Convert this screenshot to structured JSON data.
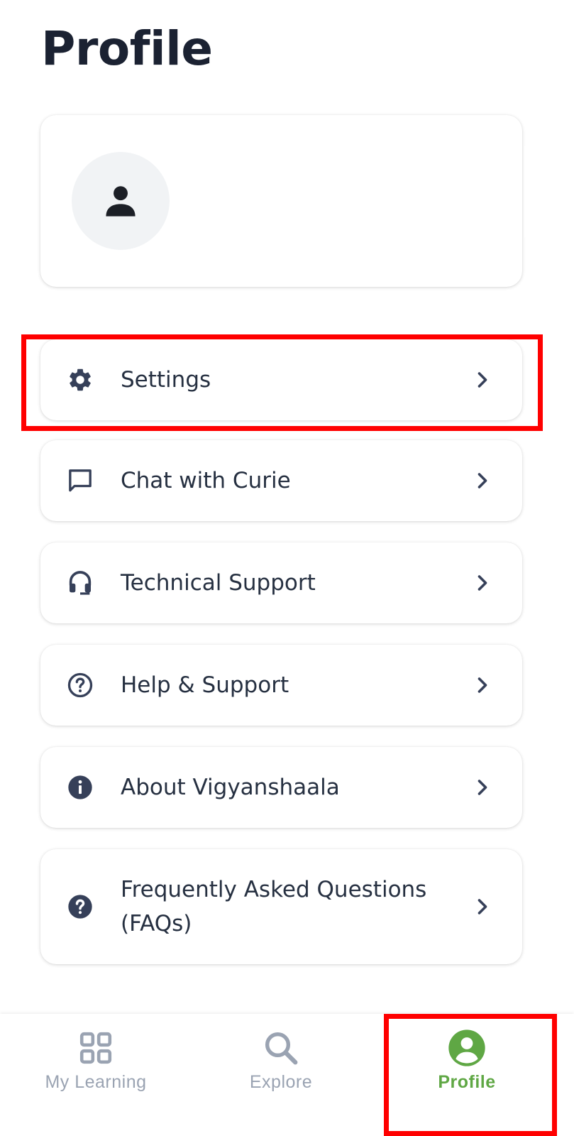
{
  "header": {
    "title": "Profile"
  },
  "profile_card": {
    "avatar_icon": "person-icon"
  },
  "menu": {
    "items": [
      {
        "label": "Settings",
        "icon": "gear-icon"
      },
      {
        "label": "Chat with Curie",
        "icon": "chat-icon"
      },
      {
        "label": "Technical Support",
        "icon": "headset-icon"
      },
      {
        "label": "Help & Support",
        "icon": "help-circle-outline-icon"
      },
      {
        "label": "About Vigyanshaala",
        "icon": "info-icon"
      },
      {
        "label": "Frequently Asked Questions (FAQs)",
        "icon": "help-circle-filled-icon"
      }
    ]
  },
  "bottom_nav": {
    "items": [
      {
        "label": "My Learning",
        "icon": "grid-icon",
        "active": false
      },
      {
        "label": "Explore",
        "icon": "search-icon",
        "active": false
      },
      {
        "label": "Profile",
        "icon": "profile-icon",
        "active": true
      }
    ]
  },
  "colors": {
    "icon_dark": "#364059",
    "active_green": "#5fa744",
    "inactive_gray": "#9aa3b2",
    "highlight_red": "#ff0000"
  }
}
